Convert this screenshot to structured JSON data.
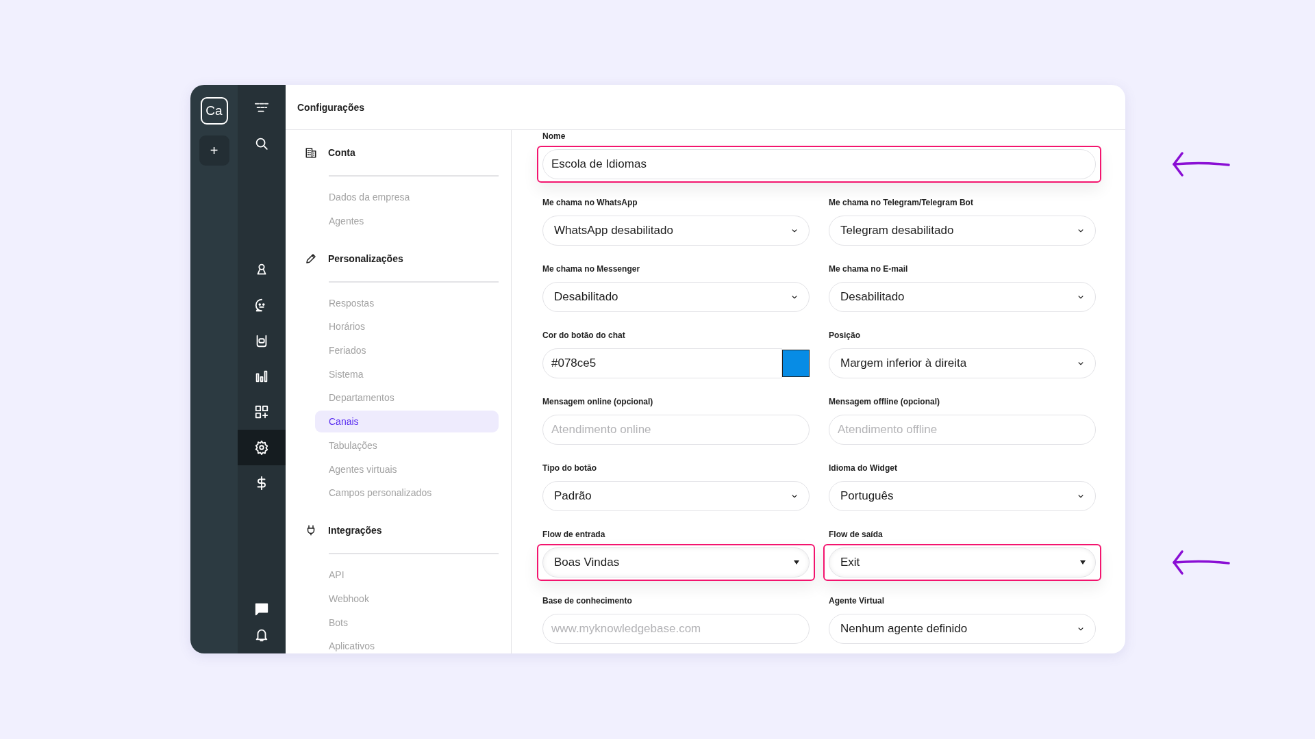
{
  "workspace_rail": {
    "avatar": "Ca",
    "add_button": "+"
  },
  "nav_rail": {
    "top": [
      {
        "kind": "logo",
        "selected": false
      },
      {
        "kind": "search",
        "selected": false
      }
    ],
    "middle": [
      {
        "kind": "person",
        "selected": false
      },
      {
        "kind": "chat-face",
        "selected": false
      },
      {
        "kind": "robot",
        "selected": false
      },
      {
        "kind": "chart",
        "selected": false
      },
      {
        "kind": "apps",
        "selected": false
      },
      {
        "kind": "settings",
        "selected": true
      },
      {
        "kind": "dollar",
        "selected": false
      }
    ],
    "bottom": [
      {
        "kind": "message",
        "selected": false
      },
      {
        "kind": "bell",
        "selected": false
      }
    ]
  },
  "header": {
    "title": "Configurações"
  },
  "menu": [
    {
      "title": "Conta",
      "kind": "building",
      "items": [
        {
          "label": "Dados da empresa",
          "selected": false
        },
        {
          "label": "Agentes",
          "selected": false
        }
      ]
    },
    {
      "title": "Personalizações",
      "kind": "pencil",
      "items": [
        {
          "label": "Respostas",
          "selected": false
        },
        {
          "label": "Horários",
          "selected": false
        },
        {
          "label": "Feriados",
          "selected": false
        },
        {
          "label": "Sistema",
          "selected": false
        },
        {
          "label": "Departamentos",
          "selected": false
        },
        {
          "label": "Canais",
          "selected": true
        },
        {
          "label": "Tabulações",
          "selected": false
        },
        {
          "label": "Agentes virtuais",
          "selected": false
        },
        {
          "label": "Campos personalizados",
          "selected": false
        }
      ]
    },
    {
      "title": "Integrações",
      "kind": "plug",
      "items": [
        {
          "label": "API",
          "selected": false
        },
        {
          "label": "Webhook",
          "selected": false
        },
        {
          "label": "Bots",
          "selected": false
        },
        {
          "label": "Aplicativos",
          "selected": false
        }
      ]
    }
  ],
  "form": {
    "rows": [
      {
        "fields": [
          {
            "label": "Nome",
            "kind": "text",
            "value": "Escola de Idiomas",
            "highlighted": true
          }
        ]
      },
      {
        "fields": [
          {
            "label": "Me chama no WhatsApp",
            "kind": "select",
            "value": "WhatsApp desabilitado",
            "highlighted": false
          },
          {
            "label": "Me chama no Telegram/Telegram Bot",
            "kind": "select",
            "value": "Telegram desabilitado",
            "highlighted": false
          }
        ]
      },
      {
        "fields": [
          {
            "label": "Me chama no Messenger",
            "kind": "select",
            "value": "Desabilitado",
            "highlighted": false
          },
          {
            "label": "Me chama no E-mail",
            "kind": "select",
            "value": "Desabilitado",
            "highlighted": false
          }
        ]
      },
      {
        "fields": [
          {
            "label": "Cor do botão do chat",
            "kind": "color",
            "value": "#078ce5",
            "highlighted": false
          },
          {
            "label": "Posição",
            "kind": "select",
            "value": "Margem inferior à direita",
            "highlighted": false
          }
        ]
      },
      {
        "fields": [
          {
            "label": "Mensagem online (opcional)",
            "kind": "text",
            "placeholder": "Atendimento online",
            "highlighted": false
          },
          {
            "label": "Mensagem offline (opcional)",
            "kind": "text",
            "placeholder": "Atendimento offline",
            "highlighted": false
          }
        ]
      },
      {
        "fields": [
          {
            "label": "Tipo do botão",
            "kind": "select",
            "value": "Padrão",
            "highlighted": false
          },
          {
            "label": "Idioma do Widget",
            "kind": "select",
            "value": "Português",
            "highlighted": false
          }
        ]
      },
      {
        "fields": [
          {
            "label": "Flow de entrada",
            "kind": "dropdown",
            "value": "Boas Vindas",
            "highlighted": true
          },
          {
            "label": "Flow de saída",
            "kind": "dropdown",
            "value": "Exit",
            "highlighted": true
          }
        ]
      },
      {
        "fields": [
          {
            "label": "Base de conhecimento",
            "kind": "text",
            "placeholder": "www.myknowledgebase.com",
            "highlighted": false
          },
          {
            "label": "Agente Virtual",
            "kind": "select",
            "value": "Nenhum agente definido",
            "highlighted": false
          }
        ]
      }
    ]
  }
}
